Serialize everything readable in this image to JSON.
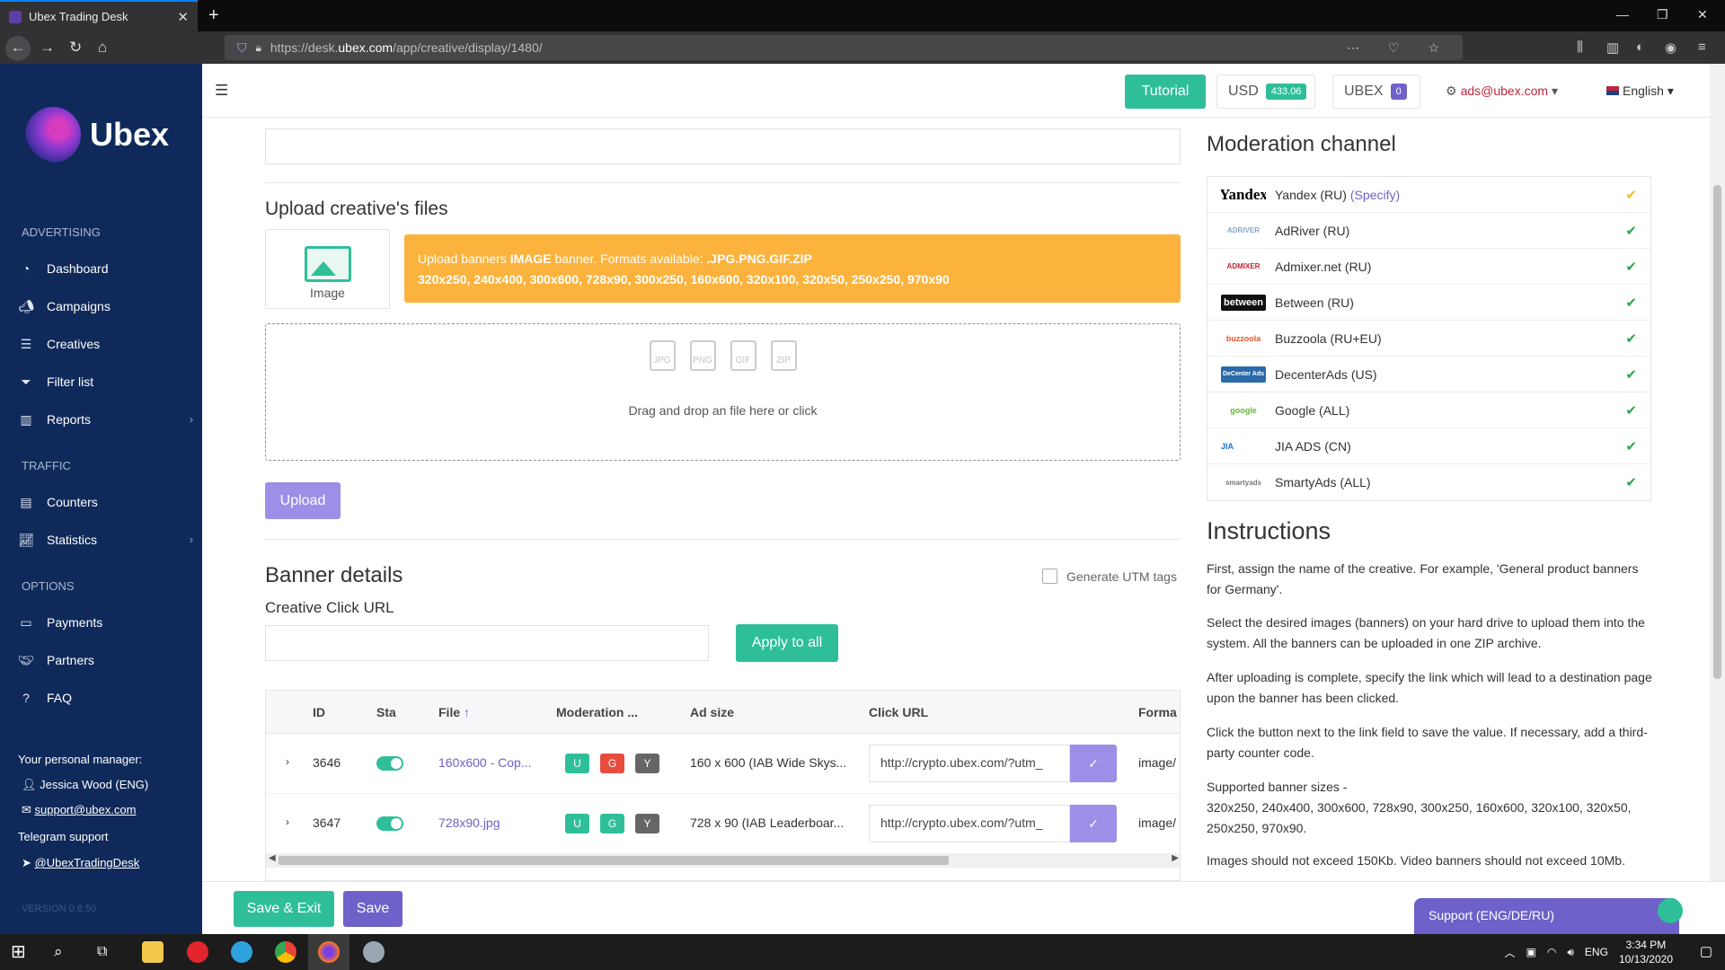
{
  "browser": {
    "tab_title": "Ubex Trading Desk",
    "url_prefix": "https://desk.",
    "url_host": "ubex.com",
    "url_path": "/app/creative/display/1480/"
  },
  "sidebar": {
    "logo": "Ubex",
    "sections": {
      "advertising": "ADVERTISING",
      "traffic": "TRAFFIC",
      "options": "OPTIONS"
    },
    "items": [
      {
        "label": "Dashboard",
        "icon": "dashboard-icon"
      },
      {
        "label": "Campaigns",
        "icon": "megaphone-icon"
      },
      {
        "label": "Creatives",
        "icon": "list-icon"
      },
      {
        "label": "Filter list",
        "icon": "filter-icon"
      },
      {
        "label": "Reports",
        "icon": "bar-chart-icon"
      },
      {
        "label": "Counters",
        "icon": "counter-icon"
      },
      {
        "label": "Statistics",
        "icon": "line-chart-icon"
      },
      {
        "label": "Payments",
        "icon": "credit-card-icon"
      },
      {
        "label": "Partners",
        "icon": "handshake-icon"
      },
      {
        "label": "FAQ",
        "icon": "question-icon"
      }
    ],
    "manager_title": "Your personal manager:",
    "manager_name": "Jessica Wood (ENG)",
    "manager_email": "support@ubex.com",
    "telegram_title": "Telegram support",
    "telegram_handle": "@UbexTradingDesk",
    "version": "VERSION 0.8.50"
  },
  "header": {
    "tutorial": "Tutorial",
    "usd_label": "USD",
    "usd_value": "433.06",
    "ubex_label": "UBEX",
    "ubex_value": "0",
    "account": "ads@ubex.com",
    "language": "English"
  },
  "upload": {
    "title": "Upload creative's files",
    "image_tile": "Image",
    "notice_prefix": "Upload banners ",
    "notice_bold": "IMAGE",
    "notice_mid": " banner. Formats available: ",
    "notice_formats": ".JPG.PNG.GIF.ZIP",
    "notice_sizes": "320x250, 240x400, 300x600, 728x90, 300x250, 160x600, 320x100, 320x50, 250x250, 970x90",
    "format_icons": [
      "JPG",
      "PNG",
      "GIF",
      "ZIP"
    ],
    "drop_text": "Drag and drop an file here or click",
    "upload_button": "Upload"
  },
  "banner": {
    "title": "Banner details",
    "utm_label": "Generate UTM tags",
    "click_url_label": "Creative Click URL",
    "apply_all": "Apply to all",
    "columns": [
      "ID",
      "Sta",
      "File",
      "Moderation ...",
      "Ad size",
      "Click URL",
      "Forma"
    ],
    "rows": [
      {
        "id": "3646",
        "file": "160x600 - Cop...",
        "mod": [
          "U",
          "G",
          "Y"
        ],
        "size": "160 x 600 (IAB Wide Skys...",
        "url": "http://crypto.ubex.com/?utm_",
        "format": "image/"
      },
      {
        "id": "3647",
        "file": "728x90.jpg",
        "mod": [
          "U",
          "G",
          "Y"
        ],
        "size": "728 x 90 (IAB Leaderboar...",
        "url": "http://crypto.ubex.com/?utm_",
        "format": "image/"
      }
    ]
  },
  "moderation": {
    "title": "Moderation channel",
    "channels": [
      {
        "name": "Yandex (RU)",
        "specify": "(Specify)",
        "logo": "Yandex",
        "check_color": "#f5b82e"
      },
      {
        "name": "AdRiver (RU)",
        "logo": "ADRIVER",
        "check_color": "#2ea44f"
      },
      {
        "name": "Admixer.net (RU)",
        "logo": "ADMIXER",
        "check_color": "#2ea44f"
      },
      {
        "name": "Between (RU)",
        "logo": "between",
        "check_color": "#2ea44f"
      },
      {
        "name": "Buzzoola (RU+EU)",
        "logo": "buzzoola",
        "check_color": "#2ea44f"
      },
      {
        "name": "DecenterAds (US)",
        "logo": "DeCenter Ads",
        "check_color": "#2ea44f"
      },
      {
        "name": "Google (ALL)",
        "logo": "google",
        "check_color": "#2ea44f"
      },
      {
        "name": "JIA ADS (CN)",
        "logo": "JIA",
        "check_color": "#2ea44f"
      },
      {
        "name": "SmartyAds (ALL)",
        "logo": "smartyads",
        "check_color": "#2ea44f"
      }
    ]
  },
  "instructions": {
    "title": "Instructions",
    "paragraphs": [
      "First, assign the name of the creative. For example, 'General product banners for Germany'.",
      "Select the desired images (banners) on your hard drive to upload them into the system. All the banners can be uploaded in one ZIP archive.",
      "After uploading is complete, specify the link which will lead to a destination page upon the banner has been clicked.",
      "Click the button next to the link field to save the value. If necessary, add a third-party counter code.",
      "Supported banner sizes -",
      "320x250, 240x400, 300x600, 728x90, 300x250, 160x600, 320x100, 320x50, 250x250, 970x90.",
      "Images should not exceed 150Kb. Video banners should not exceed 10Mb."
    ]
  },
  "footer": {
    "save_exit": "Save & Exit",
    "save": "Save",
    "support": "Support (ENG/DE/RU)"
  },
  "taskbar": {
    "time": "3:34 PM",
    "date": "10/13/2020",
    "lang": "ENG"
  },
  "colors": {
    "sidebar": "#0f2a5a",
    "accent_green": "#2fbf98",
    "accent_purple": "#6e61c9",
    "notice": "#fbb33d"
  }
}
